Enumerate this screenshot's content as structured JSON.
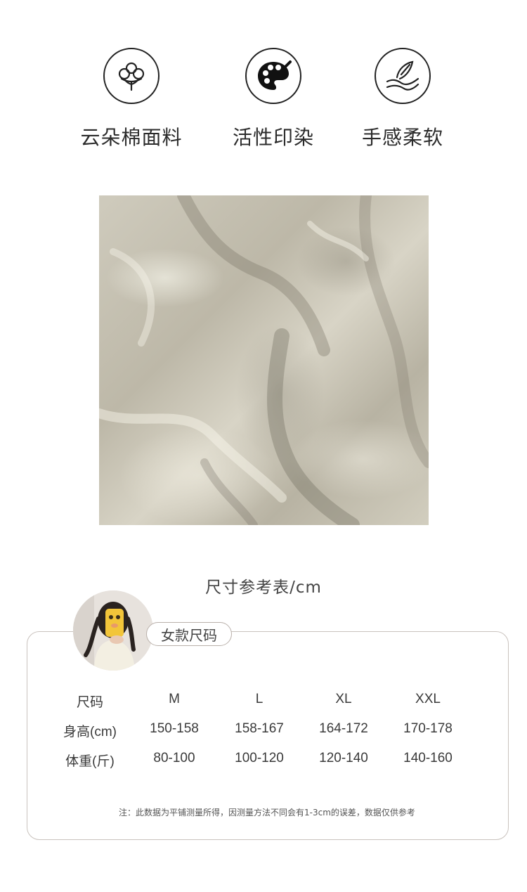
{
  "features": [
    {
      "icon": "cotton-icon",
      "label": "云朵棉面料"
    },
    {
      "icon": "palette-icon",
      "label": "活性印染"
    },
    {
      "icon": "hand-feather-icon",
      "label": "手感柔软"
    }
  ],
  "size_chart": {
    "title": "尺寸参考表/cm",
    "tag": "女款尺码",
    "rows": [
      {
        "label": "尺码",
        "values": [
          "M",
          "L",
          "XL",
          "XXL"
        ]
      },
      {
        "label": "身高(cm)",
        "values": [
          "150-158",
          "158-167",
          "164-172",
          "170-178"
        ]
      },
      {
        "label": "体重(斤)",
        "values": [
          "80-100",
          "100-120",
          "120-140",
          "140-160"
        ]
      }
    ],
    "note": "注：此数据为平铺测量所得，因测量方法不同会有1-3cm的误差，数据仅供参考"
  }
}
